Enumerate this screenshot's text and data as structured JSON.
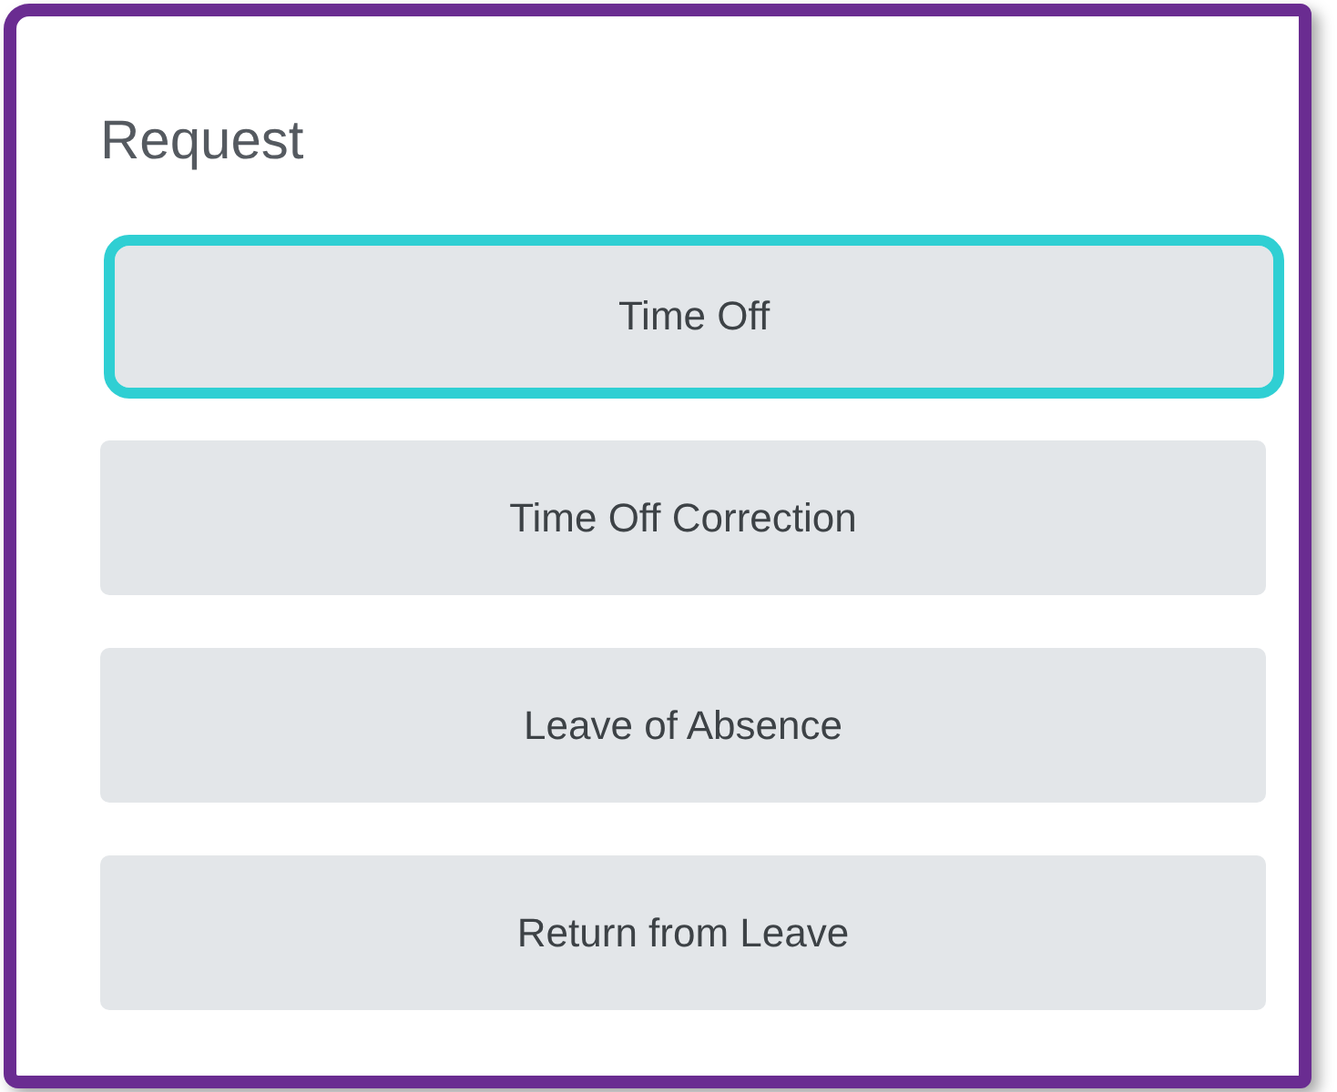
{
  "title": "Request",
  "buttons": [
    {
      "label": "Time Off",
      "focused": true
    },
    {
      "label": "Time Off Correction",
      "focused": false
    },
    {
      "label": "Leave of Absence",
      "focused": false
    },
    {
      "label": "Return from Leave",
      "focused": false
    }
  ]
}
